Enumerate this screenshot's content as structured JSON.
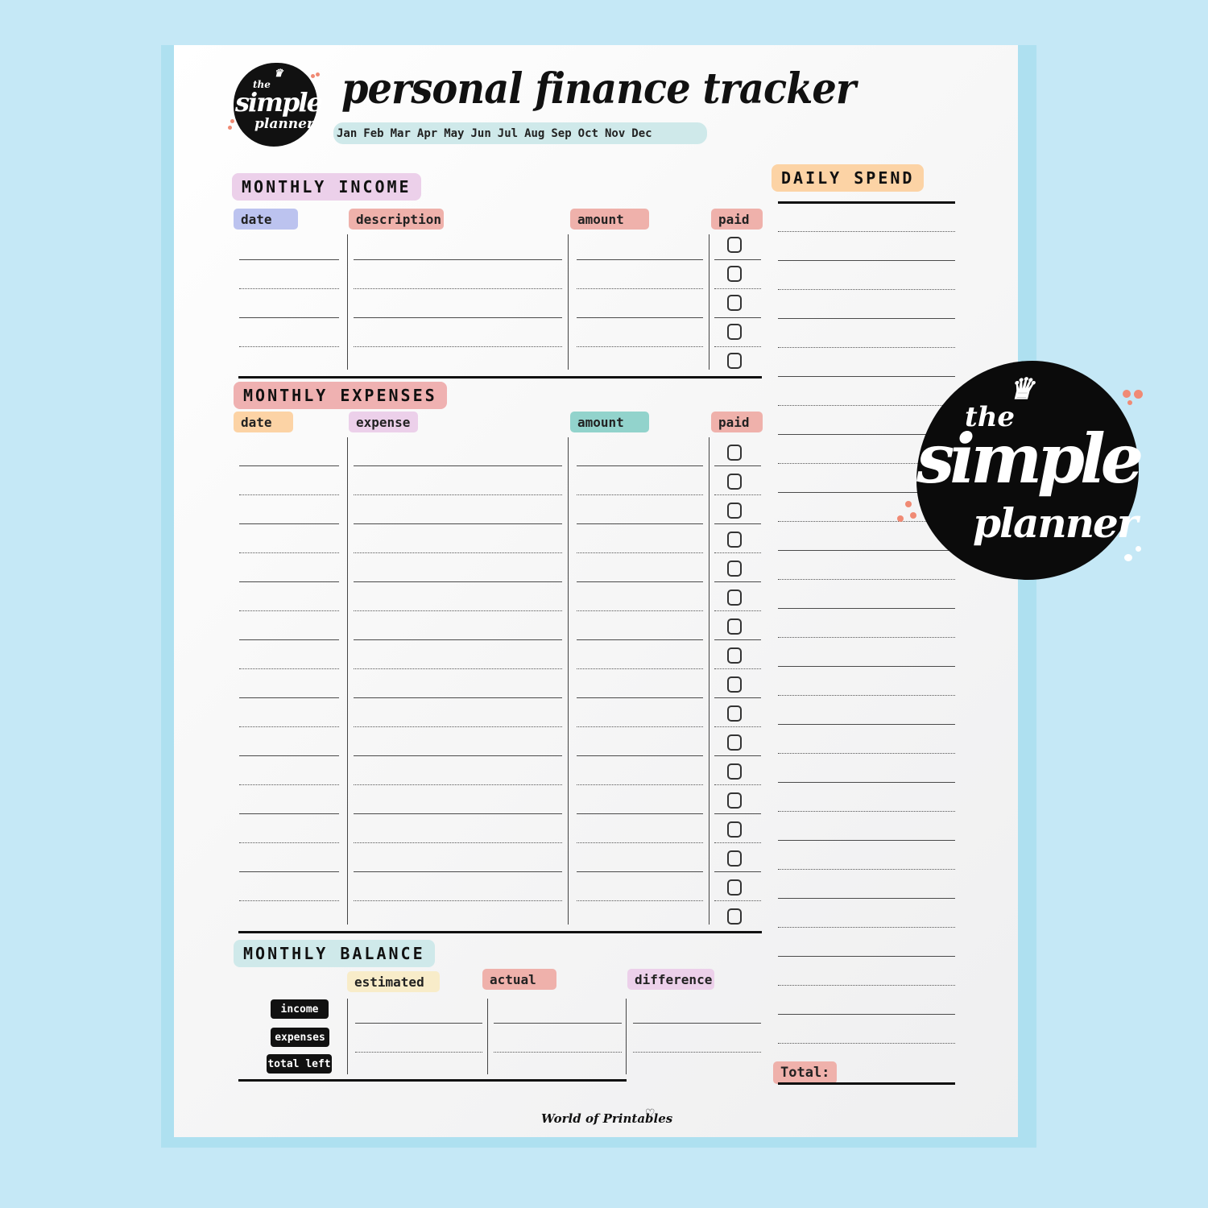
{
  "background_color": "#c5e8f6",
  "header": {
    "logo": {
      "line1": "the",
      "line2": "simple",
      "line3": "planner"
    },
    "title": "personal finance tracker",
    "months": [
      "Jan",
      "Feb",
      "Mar",
      "Apr",
      "May",
      "Jun",
      "Jul",
      "Aug",
      "Sep",
      "Oct",
      "Nov",
      "Dec"
    ]
  },
  "monthly_income": {
    "title": "MONTHLY INCOME",
    "title_color": "#ecd0ea",
    "columns": [
      {
        "label": "date",
        "color": "#bcc3ef"
      },
      {
        "label": "description",
        "color": "#efb1ab"
      },
      {
        "label": "amount",
        "color": "#efb1ab"
      },
      {
        "label": "paid",
        "color": "#efb1ab"
      }
    ],
    "rows": 5,
    "paid_checked": [
      false,
      false,
      false,
      false,
      false
    ]
  },
  "monthly_expenses": {
    "title": "MONTHLY EXPENSES",
    "title_color": "#efb1b1",
    "columns": [
      {
        "label": "date",
        "color": "#fcd3a5"
      },
      {
        "label": "expense",
        "color": "#ecd0ea"
      },
      {
        "label": "amount",
        "color": "#92d3cc"
      },
      {
        "label": "paid",
        "color": "#efb1ab"
      }
    ],
    "rows": 17,
    "paid_checked": [
      false,
      false,
      false,
      false,
      false,
      false,
      false,
      false,
      false,
      false,
      false,
      false,
      false,
      false,
      false,
      false,
      false
    ]
  },
  "monthly_balance": {
    "title": "MONTHLY BALANCE",
    "title_color": "#cfe9ea",
    "columns": [
      {
        "label": "estimated",
        "color": "#f8ecc9"
      },
      {
        "label": "actual",
        "color": "#efb1ab"
      },
      {
        "label": "difference",
        "color": "#ecd0ea"
      }
    ],
    "rows": [
      "income",
      "expenses",
      "total left"
    ]
  },
  "daily_spend": {
    "title": "DAILY SPEND",
    "title_color": "#fcd3a5",
    "total_label": "Total:",
    "total_color": "#efb1ab"
  },
  "footer": {
    "brand": "World of Printables",
    "heart_icon": "♡"
  },
  "badge_logo": {
    "line1": "the",
    "line2": "simple",
    "line3": "planner"
  }
}
